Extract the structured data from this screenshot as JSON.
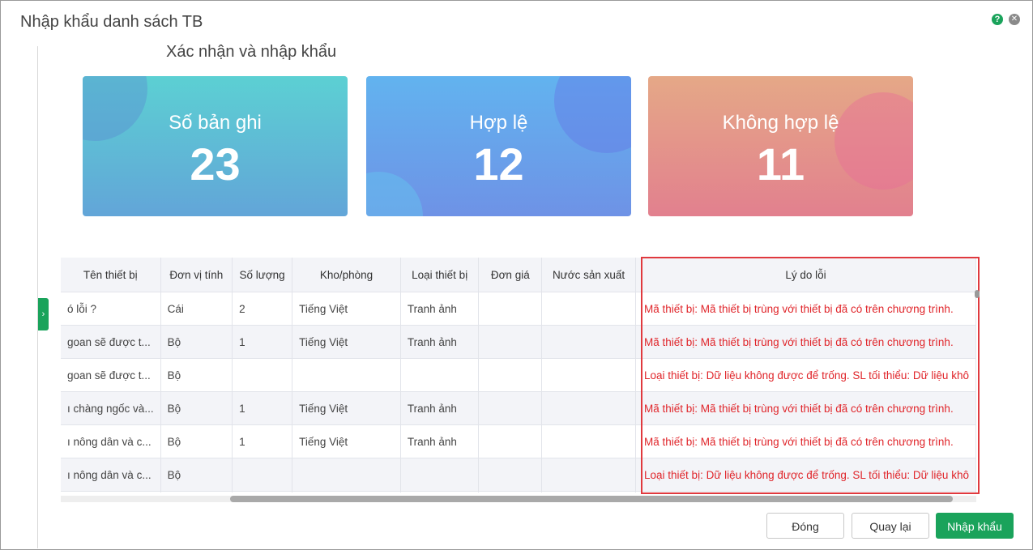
{
  "dialog": {
    "title": "Nhập khẩu danh sách TB",
    "help_icon": "?",
    "close_icon": "✕"
  },
  "section_title": "Xác nhận và nhập khẩu",
  "stats": {
    "total": {
      "label": "Số bản ghi",
      "value": "23"
    },
    "valid": {
      "label": "Hợp lệ",
      "value": "12"
    },
    "invalid": {
      "label": "Không hợp lệ",
      "value": "11"
    }
  },
  "table": {
    "columns": [
      "Tên thiết bị",
      "Đơn vị tính",
      "Số lượng",
      "Kho/phòng",
      "Loại thiết bị",
      "Đơn giá",
      "Nước sản xuất",
      "Lý do lỗi"
    ],
    "rows": [
      [
        "ó lỗi ?",
        "Cái",
        "2",
        "Tiếng Việt",
        "Tranh ảnh",
        "",
        "",
        "Mã thiết bị: Mã thiết bị trùng với thiết bị đã có trên chương trình."
      ],
      [
        "goan sẽ được t...",
        "Bộ",
        "1",
        "Tiếng Việt",
        "Tranh ảnh",
        "",
        "",
        "Mã thiết bị: Mã thiết bị trùng với thiết bị đã có trên chương trình."
      ],
      [
        "goan sẽ được t...",
        "Bộ",
        "",
        "",
        "",
        "",
        "",
        "Loại thiết bị: Dữ liệu không được để trống. SL tối thiểu: Dữ liệu khô"
      ],
      [
        "ı chàng ngốc và...",
        "Bộ",
        "1",
        "Tiếng Việt",
        "Tranh ảnh",
        "",
        "",
        "Mã thiết bị: Mã thiết bị trùng với thiết bị đã có trên chương trình."
      ],
      [
        "ı nông dân và c...",
        "Bộ",
        "1",
        "Tiếng Việt",
        "Tranh ảnh",
        "",
        "",
        "Mã thiết bị: Mã thiết bị trùng với thiết bị đã có trên chương trình."
      ],
      [
        "ı nông dân và c...",
        "Bộ",
        "",
        "",
        "",
        "",
        "",
        "Loại thiết bị: Dữ liệu không được để trống. SL tối thiểu: Dữ liệu khô"
      ],
      [
        "",
        "",
        "",
        "",
        "",
        "",
        "",
        ""
      ]
    ]
  },
  "buttons": {
    "close": "Đóng",
    "back": "Quay lại",
    "import": "Nhập khẩu"
  },
  "colors": {
    "accent": "#1aa35b",
    "error_text": "#e0252a",
    "error_highlight": "#e0393e"
  }
}
